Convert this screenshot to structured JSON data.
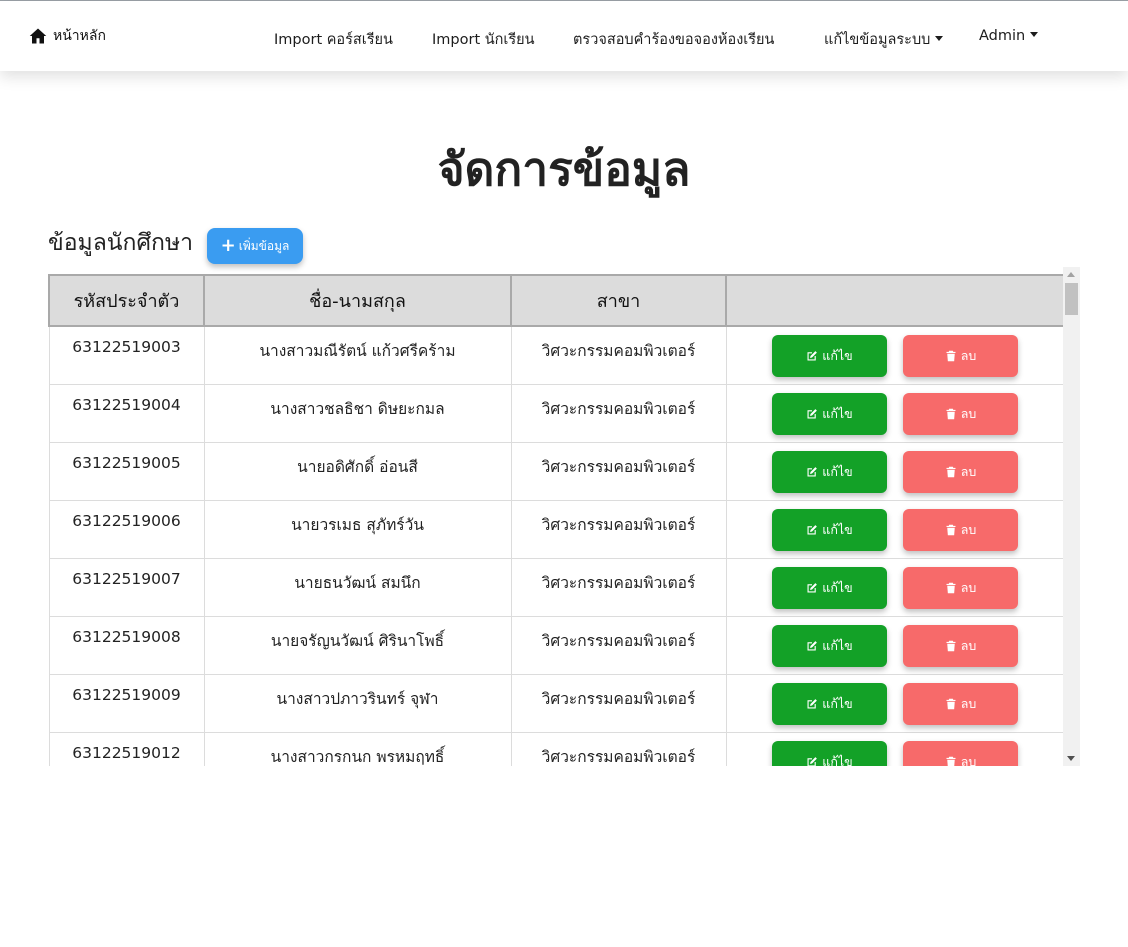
{
  "nav": {
    "home": "หน้าหลัก",
    "items": [
      {
        "label": "Import คอร์สเรียน"
      },
      {
        "label": "Import นักเรียน"
      },
      {
        "label": "ตรวจสอบคำร้องขอจองห้องเรียน"
      },
      {
        "label": "แก้ไขข้อมูลระบบ",
        "dropdown": true
      },
      {
        "label": "Admin",
        "dropdown": true
      }
    ]
  },
  "page": {
    "title": "จัดการข้อมูล",
    "section_title": "ข้อมูลนักศึกษา",
    "add_button": "เพิ่มข้อมูล"
  },
  "table": {
    "headers": [
      "รหัสประจำตัว",
      "ชื่อ-นามสกุล",
      "สาขา",
      ""
    ],
    "edit_label": "แก้ไข",
    "delete_label": "ลบ",
    "rows": [
      {
        "id": "63122519003",
        "name": "นางสาวมณีรัตน์ แก้วศรีคร้าม",
        "major": "วิศวะกรรมคอมพิวเตอร์"
      },
      {
        "id": "63122519004",
        "name": "นางสาวชลธิชา ดิษยะกมล",
        "major": "วิศวะกรรมคอมพิวเตอร์"
      },
      {
        "id": "63122519005",
        "name": "นายอดิศักดิ์ อ่อนสี",
        "major": "วิศวะกรรมคอมพิวเตอร์"
      },
      {
        "id": "63122519006",
        "name": "นายวรเมธ สุภัทร์วัน",
        "major": "วิศวะกรรมคอมพิวเตอร์"
      },
      {
        "id": "63122519007",
        "name": "นายธนวัฒน์ สมนึก",
        "major": "วิศวะกรรมคอมพิวเตอร์"
      },
      {
        "id": "63122519008",
        "name": "นายจรัญนวัฒน์ ศิรินาโพธิ์",
        "major": "วิศวะกรรมคอมพิวเตอร์"
      },
      {
        "id": "63122519009",
        "name": "นางสาวปภาวรินทร์ จุฬา",
        "major": "วิศวะกรรมคอมพิวเตอร์"
      },
      {
        "id": "63122519012",
        "name": "นางสาวกรกนก พรหมฤทธิ์",
        "major": "วิศวะกรรมคอมพิวเตอร์"
      }
    ]
  },
  "colors": {
    "add_button": "#3a9cf1",
    "edit_button": "#13a127",
    "delete_button": "#f76a6a",
    "header_bg": "#dcdcdc"
  }
}
